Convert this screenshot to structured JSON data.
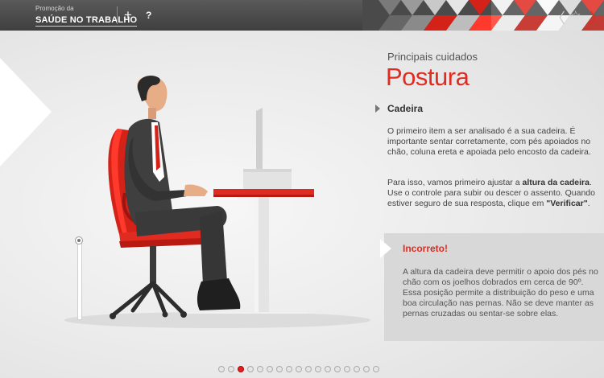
{
  "header": {
    "brand_small": "Promoção da",
    "brand_big": "SAÚDE NO TRABALHO",
    "plus_label": "+",
    "help_label": "?",
    "prev_label": "〈",
    "favorite_label": "☆",
    "next_label": "〉"
  },
  "content": {
    "subtitle": "Principais cuidados",
    "title": "Postura",
    "section_title": "Cadeira",
    "paragraph1": "O primeiro item a ser analisado é a sua cadeira. É importante sentar corretamente, com pés apoiados no chão, coluna ereta e apoiada pelo encosto da cadeira.",
    "paragraph2_pre": "Para isso, vamos primeiro ajustar a ",
    "paragraph2_bold": "altura da cadeira",
    "paragraph2_post": ". Use o controle para subir ou descer o assento. Quando estiver seguro de sua resposta, clique em ",
    "paragraph2_quote": "\"Verificar\"",
    "paragraph2_end": "."
  },
  "feedback": {
    "title": "Incorreto!",
    "text": "A altura da cadeira deve permitir o apoio dos pés no chão com os joelhos dobrados em cerca de 90º. Essa posição permite a distribuição do peso e uma boa circulação nas pernas. Não se deve manter as pernas cruzadas ou sentar-se sobre elas."
  },
  "slider": {
    "level": 1.0
  },
  "pager": {
    "total": 17,
    "active_index": 2
  },
  "colors": {
    "accent": "#e02b20",
    "chair": "#d42218",
    "suit": "#3a3a3a",
    "skin": "#e6ad86"
  }
}
